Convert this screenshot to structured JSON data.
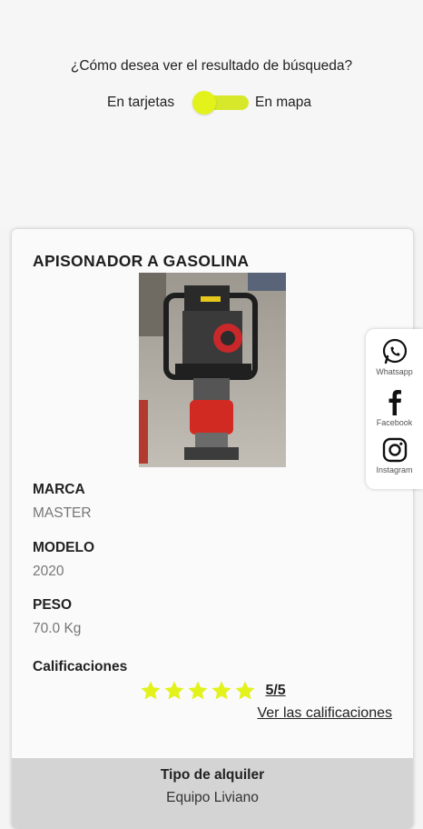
{
  "view_toggle": {
    "question": "¿Cómo desea ver el resultado de búsqueda?",
    "left_label": "En tarjetas",
    "right_label": "En mapa",
    "accent_color": "#e2f21a"
  },
  "product": {
    "title": "APISONADOR A GASOLINA",
    "brand_label": "MARCA",
    "brand_value": "MASTER",
    "model_label": "MODELO",
    "model_value": "2020",
    "weight_label": "PESO",
    "weight_value": "70.0 Kg",
    "ratings_label": "Calificaciones",
    "rating_stars": 5,
    "rating_score": "5/5",
    "ratings_link": "Ver las calificaciones",
    "star_color": "#e2f21a"
  },
  "rental": {
    "label": "Tipo de alquiler",
    "value": "Equipo Liviano"
  },
  "social": {
    "whatsapp": "Whatsapp",
    "facebook": "Facebook",
    "instagram": "Instagram"
  }
}
